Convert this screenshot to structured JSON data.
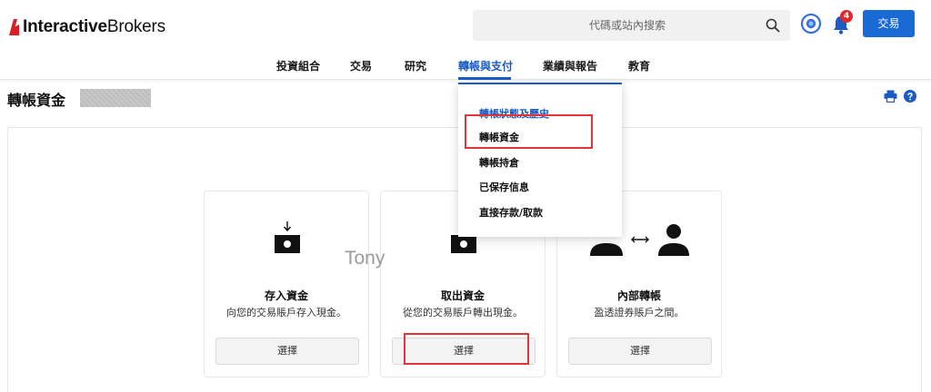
{
  "header": {
    "logo_bold": "Interactive",
    "logo_regular": "Brokers",
    "search_placeholder": "代碼或站內搜索",
    "notification_count": "4",
    "trade_button": "交易"
  },
  "nav": {
    "items": [
      {
        "label": "投資組合"
      },
      {
        "label": "交易"
      },
      {
        "label": "研究"
      },
      {
        "label": "轉帳與支付"
      },
      {
        "label": "業績與報告"
      },
      {
        "label": "教育"
      }
    ],
    "active": "轉帳與支付"
  },
  "page": {
    "title": "轉帳資金"
  },
  "dropdown": {
    "items": [
      {
        "label": "轉帳狀態及歷史"
      },
      {
        "label": "轉帳資金"
      },
      {
        "label": "轉帳持倉"
      },
      {
        "label": "已保存信息"
      },
      {
        "label": "直接存款/取款"
      }
    ]
  },
  "cards": [
    {
      "title": "存入資金",
      "desc": "向您的交易賬戶存入現金。",
      "button": "選擇",
      "icon": "deposit-icon"
    },
    {
      "title": "取出資金",
      "desc": "從您的交易賬戶轉出現金。",
      "button": "選擇",
      "icon": "withdraw-icon"
    },
    {
      "title": "內部轉帳",
      "desc": "盈透證券賬戶之間。",
      "button": "選擇",
      "icon": "internal-transfer-icon"
    }
  ],
  "watermark": "Tony",
  "colors": {
    "brand_red": "#d81f26",
    "accent_blue": "#1a5bc4",
    "trade_button": "#1a6ad6",
    "highlight": "#e0353b"
  }
}
